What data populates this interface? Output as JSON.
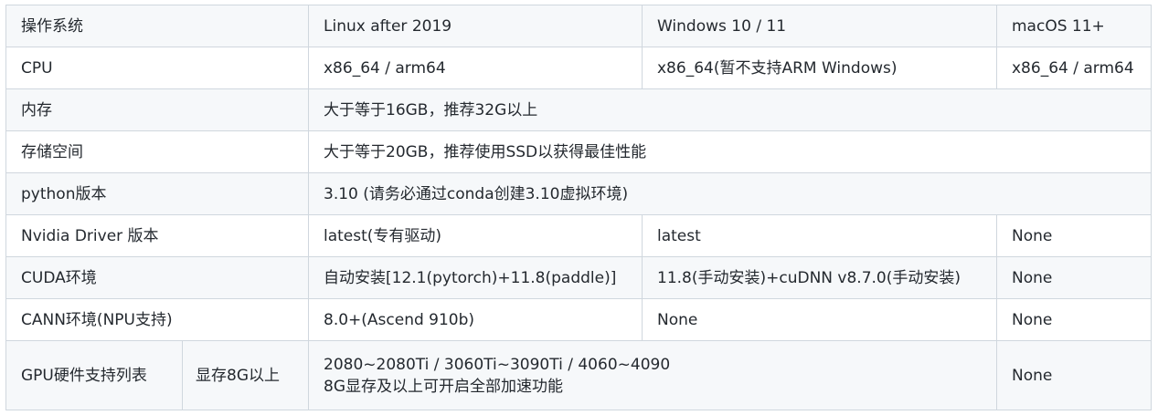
{
  "table": {
    "rows": {
      "os": {
        "label": "操作系统",
        "linux": "Linux after 2019",
        "windows": "Windows 10 / 11",
        "mac": "macOS 11+"
      },
      "cpu": {
        "label": "CPU",
        "linux": "x86_64 / arm64",
        "windows": "x86_64(暂不支持ARM Windows)",
        "mac": "x86_64 / arm64"
      },
      "memory": {
        "label": "内存",
        "value": "大于等于16GB，推荐32G以上"
      },
      "storage": {
        "label": "存储空间",
        "value": "大于等于20GB，推荐使用SSD以获得最佳性能"
      },
      "python": {
        "label": "python版本",
        "value": "3.10 (请务必通过conda创建3.10虚拟环境)"
      },
      "nvidia": {
        "label": "Nvidia Driver 版本",
        "linux": "latest(专有驱动)",
        "windows": "latest",
        "mac": "None"
      },
      "cuda": {
        "label": "CUDA环境",
        "linux": "自动安装[12.1(pytorch)+11.8(paddle)]",
        "windows": "11.8(手动安装)+cuDNN v8.7.0(手动安装)",
        "mac": "None"
      },
      "cann": {
        "label": "CANN环境(NPU支持)",
        "linux": "8.0+(Ascend 910b)",
        "windows": "None",
        "mac": "None"
      },
      "gpu": {
        "label": "GPU硬件支持列表",
        "sub_label": "显存8G以上",
        "line1": "2080~2080Ti / 3060Ti~3090Ti / 4060~4090",
        "line2": "8G显存及以上可开启全部加速功能",
        "mac": "None"
      }
    }
  }
}
